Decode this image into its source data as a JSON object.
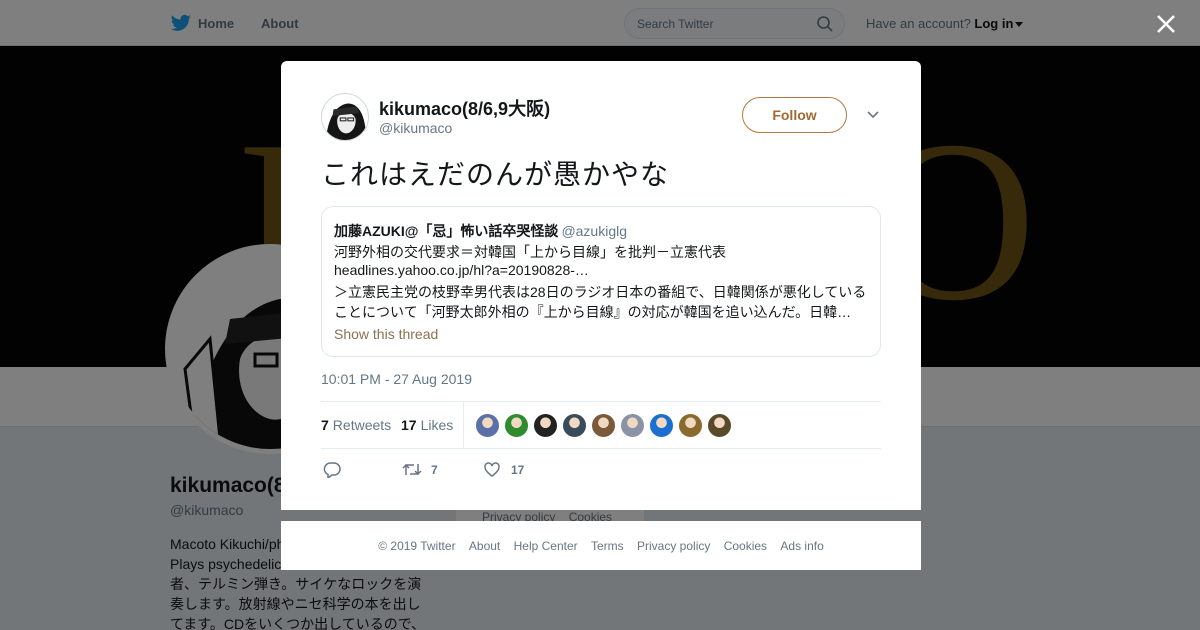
{
  "topbar": {
    "home_label": "Home",
    "about_label": "About",
    "search_placeholder": "Search Twitter",
    "account_prompt": "Have an account?",
    "login_label": "Log in"
  },
  "profile": {
    "name": "kikumaco(8",
    "handle": "@kikumaco",
    "bio_lines": [
      "Macoto Kikuchi/ph",
      "Plays psychedelic",
      "者、テルミン弾き。サイケなロックを演",
      "奏します。放射線やニセ科学の本を出し",
      "てます。CDをいくつか出しているので、"
    ],
    "footer_links": [
      "Privacy policy",
      "Cookies"
    ]
  },
  "tweet": {
    "author_name": "kikumaco(8/6,9大阪)",
    "author_handle": "@kikumaco",
    "follow_label": "Follow",
    "text": "これはえだのんが愚かやな",
    "quote": {
      "name": "加藤AZUKI@「忌」怖い話卒哭怪談",
      "handle": "@azukiglg",
      "lines": [
        "河野外相の交代要求＝対韓国「上から目線」を批判－立憲代表",
        "headlines.yahoo.co.jp/hl?a=20190828-…",
        "＞立憲民主党の枝野幸男代表は28日のラジオ日本の番組で、日韓関係が悪化している",
        "ことについて「河野太郎外相の『上から目線』の対応が韓国を追い込んだ。日韓…"
      ],
      "thread_label": "Show this thread"
    },
    "timestamp": "10:01 PM - 27 Aug 2019",
    "retweets_count": "7",
    "retweets_label": "Retweets",
    "likes_count": "17",
    "likes_label": "Likes",
    "action_retweet_count": "7",
    "action_like_count": "17",
    "liker_colors": [
      "#5b6fa8",
      "#2e8b2e",
      "#222222",
      "#3a4b5c",
      "#7a5a3a",
      "#8a93a6",
      "#1a6fd0",
      "#8b6a2e",
      "#5a4a2a"
    ]
  },
  "footer": {
    "links": [
      "© 2019 Twitter",
      "About",
      "Help Center",
      "Terms",
      "Privacy policy",
      "Cookies",
      "Ads info"
    ]
  },
  "colors": {
    "accent": "#b27840",
    "twitter_blue": "#1da1f2",
    "muted": "#657786"
  },
  "icons": [
    "twitter-bird-icon",
    "search-icon",
    "close-icon",
    "chevron-down-icon",
    "reply-icon",
    "retweet-icon",
    "heart-icon"
  ]
}
